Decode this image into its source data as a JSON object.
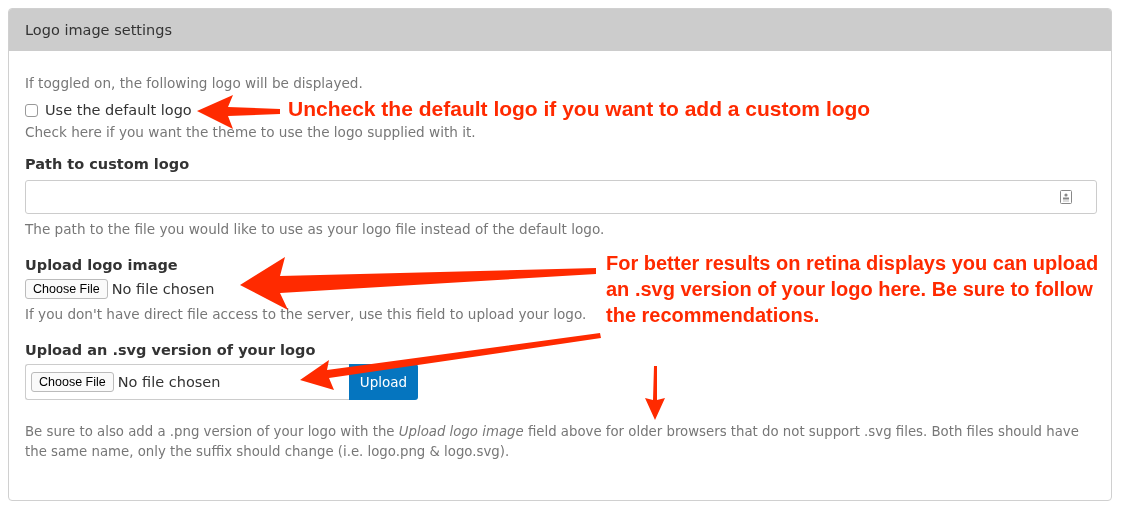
{
  "panel_title": "Logo image settings",
  "intro": "If toggled on, the following logo will be displayed.",
  "default_logo": {
    "label": "Use the default logo",
    "checked": false,
    "help": "Check here if you want the theme to use the logo supplied with it."
  },
  "custom_path": {
    "label": "Path to custom logo",
    "help": "The path to the file you would like to use as your logo file instead of the default logo."
  },
  "logo_upload": {
    "label": "Upload logo image",
    "button": "Choose File",
    "status": "No file chosen",
    "help": "If you don't have direct file access to the server, use this field to upload your logo."
  },
  "svg_upload": {
    "label": "Upload an .svg version of your logo",
    "button": "Choose File",
    "status": "No file chosen",
    "submit": "Upload",
    "help": "Be sure to also add a .png version of your logo with the *Upload logo image* field above for older browsers that do not support .svg files. Both files should have the same name, only the suffix should change (i.e. logo.png & logo.svg)."
  },
  "annotations": [
    {
      "text": "Uncheck the default logo if you want to add a custom logo"
    },
    {
      "text": "For better results on retina displays you can upload an .svg version of your logo here. Be sure to follow the recommendations."
    }
  ]
}
